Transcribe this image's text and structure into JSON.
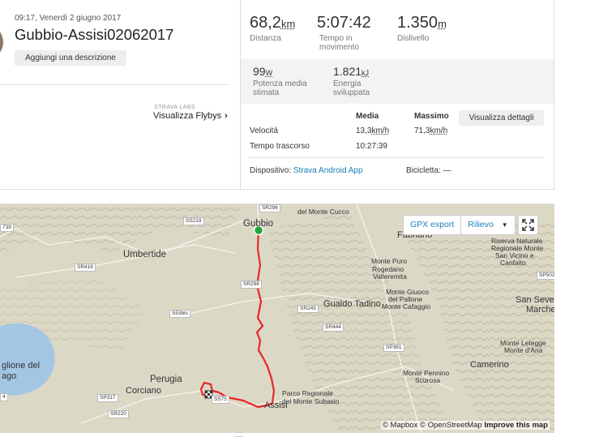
{
  "activity": {
    "date": "09:17, Venerdì 2 giugno 2017",
    "title": "Gubbio-Assisi02062017",
    "add_description": "Aggiungi una descrizione"
  },
  "flybys": {
    "labs": "STRAVA LABS",
    "label": "Visualizza Flybys",
    "chevron": "›"
  },
  "stats": {
    "distance": {
      "value": "68,2",
      "unit": "km",
      "label": "Distanza"
    },
    "moving_time": {
      "value": "5:07:42",
      "label": "Tempo in movimento"
    },
    "elevation": {
      "value": "1.350",
      "unit": "m",
      "label": "Dislivello"
    },
    "power": {
      "value": "99",
      "unit": "W",
      "label": "Potenza media stimata"
    },
    "energy": {
      "value": "1.821",
      "unit": "kJ",
      "label": "Energia sviluppata"
    }
  },
  "table": {
    "head_avg": "Media",
    "head_max": "Massimo",
    "rows": [
      {
        "label": "Velocità",
        "avg_num": "13,3",
        "avg_unit": "km/h",
        "max_num": "71,3",
        "max_unit": "km/h"
      },
      {
        "label": "Tempo trascorso",
        "avg": "10:27:39"
      }
    ],
    "details_button": "Visualizza dettagli"
  },
  "device": {
    "label": "Dispositivo:",
    "value": "Strava Android App"
  },
  "bike": {
    "label": "Bicicletta:",
    "value": "—"
  },
  "map": {
    "gpx_export": "GPX export",
    "rilievo": "Rilievo",
    "rilievo_caret": "▼",
    "attribution_prefix": "© Mapbox © OpenStreetMap",
    "attribution_link": "Improve this map",
    "colors": {
      "route": "#e8262a",
      "start": "#22a83a",
      "water": "#a4c6e4",
      "terrain": "#d9d5c4"
    },
    "labels": {
      "gubbio": "Gubbio",
      "umbertide": "Umbertide",
      "perugia": "Perugia",
      "corciano": "Corciano",
      "assisi": "Assisi",
      "gualdo": "Gualdo Tadino",
      "fabriano": "Fabriano",
      "camerino": "Camerino",
      "lago_1": "glione del",
      "lago_2": "ago",
      "cucco": "del Monte Cucco",
      "subasio_1": "Parco Regionale",
      "subasio_2": "del Monte Subasio",
      "riserva_1": "Riserva Naturale",
      "riserva_2": "Regionale Monte",
      "riserva_3": "San Vicino e",
      "riserva_4": "Canfaito",
      "puro_1": "Monte Puro",
      "puro_2": "Rogedano",
      "puro_3": "Valleremita",
      "giuoco_1": "Monte Giuoco",
      "giuoco_2": "del Pallone",
      "giuoco_3": "Monte Cafaggio",
      "penna_1": "Monte Pennino",
      "penna_2": "Scurosa",
      "letegge_1": "Monte Letegge",
      "letegge_2": "Monte d'Aria",
      "severino_1": "San Seve",
      "severino_2": "Marche",
      "r_sr296": "SR296",
      "r_ss219": "SS219",
      "r_sr416": "SR416",
      "r_sr298": "SR298",
      "r_s53bis": "S53bis",
      "r_sr245": "SR245",
      "r_sr444": "SR444",
      "r_sp361": "SP361",
      "r_sp317": "SP317",
      "r_sr220": "SR220",
      "r_ss75": "SS75",
      "r_sp502": "SP502",
      "r_739": "739",
      "r_4": "4"
    }
  }
}
